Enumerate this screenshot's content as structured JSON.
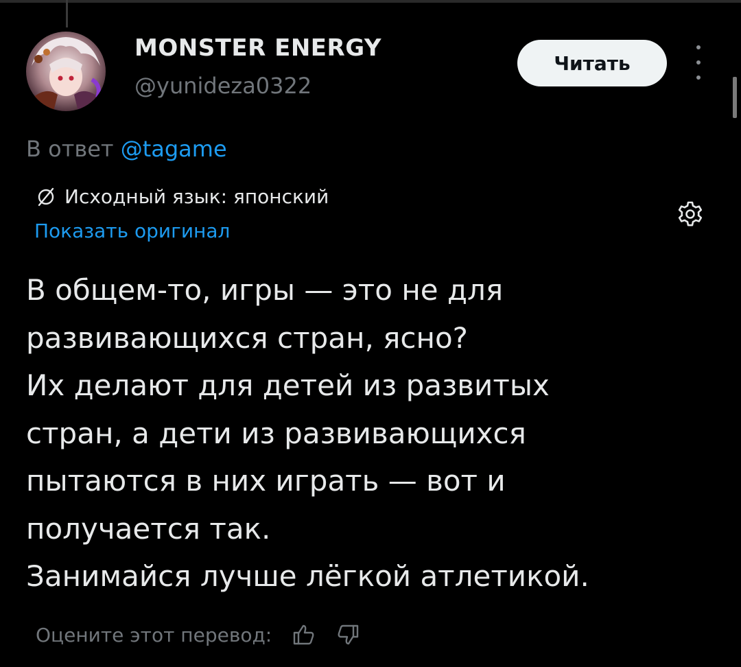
{
  "author": {
    "display_name": "MONSTER ENERGY",
    "handle": "@yunideza0322"
  },
  "follow_button": {
    "label": "Читать"
  },
  "reply": {
    "prefix": "В ответ",
    "mention": "@tagame"
  },
  "translation": {
    "source_language": "Исходный язык: японский",
    "show_original_label": "Показать оригинал",
    "rate_label": "Оцените этот перевод:"
  },
  "tweet": {
    "lines": [
      "В общем-то, игры — это не для",
      "развивающихся стран, ясно?",
      "Их делают для детей из развитых",
      "стран, а дети из развивающихся",
      "пытаются в них играть — вот и",
      "получается так.",
      "Занимайся лучше лёгкой атлетикой."
    ]
  },
  "icons": {
    "translate": "translate-icon",
    "settings": "gear-icon",
    "more": "more-vertical-icon",
    "thumbs_up": "thumbs-up-icon",
    "thumbs_down": "thumbs-down-icon"
  },
  "colors": {
    "background": "#000000",
    "text_primary": "#e7e9ea",
    "text_secondary": "#71767b",
    "accent": "#1d9bf0",
    "button_bg": "#eff3f4"
  }
}
